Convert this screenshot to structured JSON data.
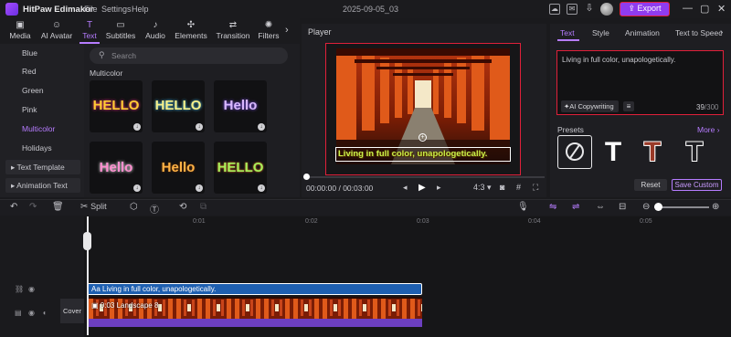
{
  "app": {
    "title": "HitPaw Edimakor",
    "menu": [
      "File",
      "Settings",
      "Help"
    ],
    "document_title": "2025-09-05_03",
    "export_label": "Export",
    "window_controls": [
      "—",
      "▢",
      "✕"
    ]
  },
  "toolbar": {
    "tools": [
      {
        "label": "Media",
        "icon": "media-icon"
      },
      {
        "label": "AI Avatar",
        "icon": "ai-avatar-icon"
      },
      {
        "label": "Text",
        "icon": "text-icon",
        "active": true
      },
      {
        "label": "Subtitles",
        "icon": "subtitles-icon"
      },
      {
        "label": "Audio",
        "icon": "audio-icon"
      },
      {
        "label": "Elements",
        "icon": "elements-icon"
      },
      {
        "label": "Transition",
        "icon": "transition-icon"
      },
      {
        "label": "Filters",
        "icon": "filters-icon"
      }
    ]
  },
  "left_nav": {
    "items": [
      "Blue",
      "Red",
      "Green",
      "Pink",
      "Multicolor",
      "Holidays"
    ],
    "active": "Multicolor",
    "groups": [
      "Text Template",
      "Animation Text"
    ]
  },
  "gallery": {
    "search_placeholder": "Search",
    "section": "Multicolor",
    "tiles": [
      {
        "text": "HELLO",
        "color": "#ffcc33"
      },
      {
        "text": "HELLO",
        "color": "#f7f08a"
      },
      {
        "text": "Hello",
        "color": "#d9b8ff"
      },
      {
        "text": "Hello",
        "color": "#ff8fd0"
      },
      {
        "text": "Hello",
        "color": "#ffb347"
      },
      {
        "text": "HELLO",
        "color": "#a6f05a"
      }
    ]
  },
  "player": {
    "title": "Player",
    "caption": "Living in full color, unapologetically.",
    "current_time": "00:00:00",
    "total_time": "00:03:00",
    "aspect": "4:3"
  },
  "right_panel": {
    "tabs": [
      "Text",
      "Style",
      "Animation",
      "Text to Speech"
    ],
    "active_tab": "Text",
    "text_value": "Living in full color, unapologetically.",
    "ai_copywriting_label": "AI Copywriting",
    "char_count": "39",
    "char_max": "/300",
    "presets_label": "Presets",
    "more_label": "More",
    "reset_label": "Reset",
    "save_custom_label": "Save Custom"
  },
  "timeline": {
    "split_label": "Split",
    "ruler": [
      "0:01",
      "0:02",
      "0:03",
      "0:04",
      "0:05"
    ],
    "text_clip_label": "Aa Living in full color, unapologetically.",
    "video_clip_label": "0:03 Landscape 8",
    "cover_label": "Cover"
  },
  "colors": {
    "accent": "#b67cff",
    "export": "#8f3cf0",
    "highlight_border": "#e0203a",
    "text_clip": "#1e5fb0",
    "audio_strip": "#6c3fc0"
  }
}
